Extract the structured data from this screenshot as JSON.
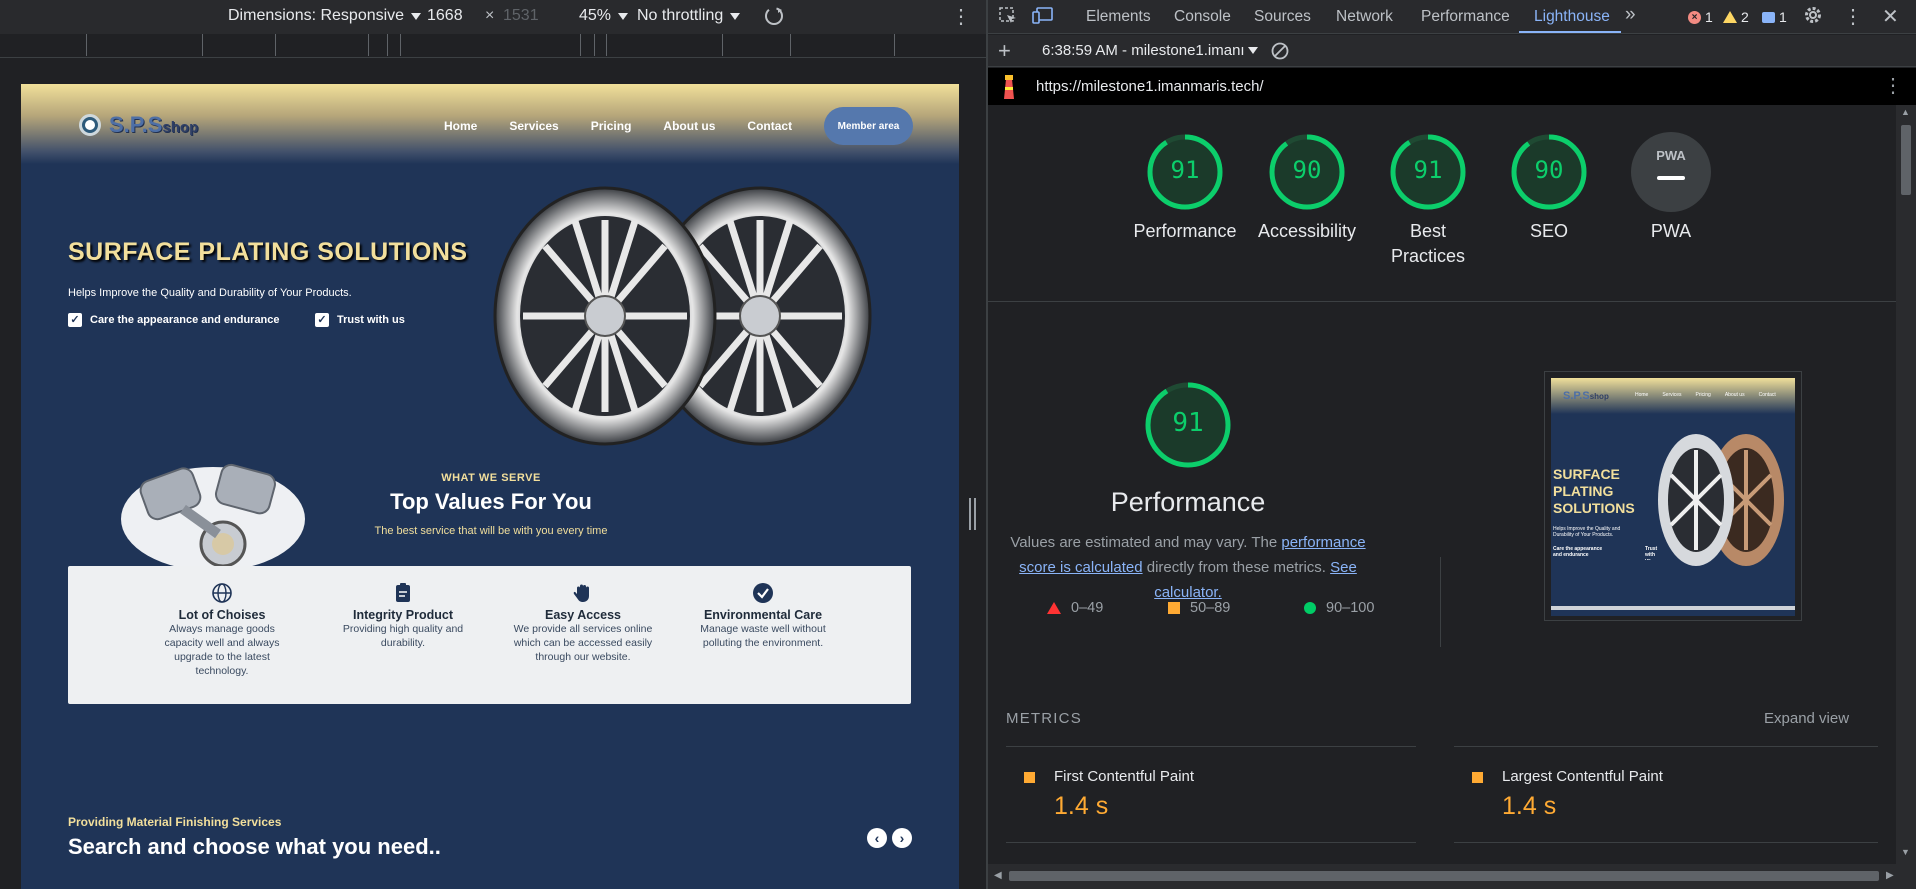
{
  "device_toolbar": {
    "dimensions_label": "Dimensions: Responsive",
    "width": "1668",
    "times": "×",
    "height": "1531",
    "zoom": "45%",
    "throttling": "No throttling"
  },
  "site": {
    "logo_text": "S.P.S",
    "logo_suffix": "shop",
    "nav": [
      "Home",
      "Services",
      "Pricing",
      "About us",
      "Contact"
    ],
    "member_button": "Member area",
    "hero_title": "SURFACE PLATING SOLUTIONS",
    "hero_subtitle": "Helps Improve the Quality and Durability of Your Products.",
    "hero_checks": [
      "Care the appearance and endurance",
      "Trust with us"
    ],
    "serve_eyebrow": "WHAT WE SERVE",
    "serve_title": "Top Values For You",
    "serve_subtitle": "The best service that will be with you every time",
    "values": [
      {
        "title": "Lot of Choises",
        "desc": "Always manage goods capacity well and always upgrade to the latest technology.",
        "icon": "globe-icon"
      },
      {
        "title": "Integrity Product",
        "desc": "Providing high quality and durability.",
        "icon": "clipboard-icon"
      },
      {
        "title": "Easy Access",
        "desc": "We provide all services online which can be accessed easily through our website.",
        "icon": "hand-icon"
      },
      {
        "title": "Environmental Care",
        "desc": "Manage waste well without polluting the environment.",
        "icon": "check-circle-icon"
      }
    ],
    "material_eyebrow": "Providing Material Finishing Services",
    "material_title": "Search and choose what you need..",
    "carousel_prev": "‹",
    "carousel_next": "›",
    "colors": {
      "navy": "#1f3457",
      "gold": "#f2df9c",
      "button_blue": "#5578ad"
    }
  },
  "devtools": {
    "tabs": [
      "Elements",
      "Console",
      "Sources",
      "Network",
      "Performance",
      "Lighthouse"
    ],
    "active_tab": "Lighthouse",
    "more_tabs": "»",
    "errors": "1",
    "warnings": "2",
    "messages": "1",
    "report_time": "6:38:59 AM - milestone1.imanı",
    "url": "https://milestone1.imanmaris.tech/"
  },
  "lighthouse": {
    "gauges": [
      {
        "label": "Performance",
        "score": 91
      },
      {
        "label": "Accessibility",
        "score": 90
      },
      {
        "label": "Best Practices",
        "score": 91
      },
      {
        "label": "SEO",
        "score": 90
      },
      {
        "label": "PWA",
        "score": null
      }
    ],
    "pwa_badge": "PWA",
    "main_score": 91,
    "main_title": "Performance",
    "desc_prefix": "Values are estimated and may vary. The ",
    "desc_link1": "performance score is calculated",
    "desc_middle": " directly from these metrics. ",
    "desc_link2": "See calculator.",
    "legend": [
      "0–49",
      "50–89",
      "90–100"
    ],
    "thumbnail": {
      "logo_text": "S.P.S",
      "logo_suffix": "shop",
      "nav": [
        "Home",
        "Services",
        "Pricing",
        "About us",
        "Contact"
      ],
      "hero_title": "SURFACE PLATING SOLUTIONS",
      "hero_subtitle": "Helps Improve the Quality and Durability of Your Products.",
      "checks": [
        "Care the appearance and endurance",
        "Trust with us"
      ]
    },
    "metrics_heading": "METRICS",
    "expand_view": "Expand view",
    "metrics": [
      {
        "name": "First Contentful Paint",
        "value": "1.4 s"
      },
      {
        "name": "Largest Contentful Paint",
        "value": "1.4 s"
      }
    ],
    "colors": {
      "pass": "#0cce6b",
      "average": "#ffaa33",
      "fail": "#ff3333",
      "link": "#8ab4f8"
    }
  }
}
